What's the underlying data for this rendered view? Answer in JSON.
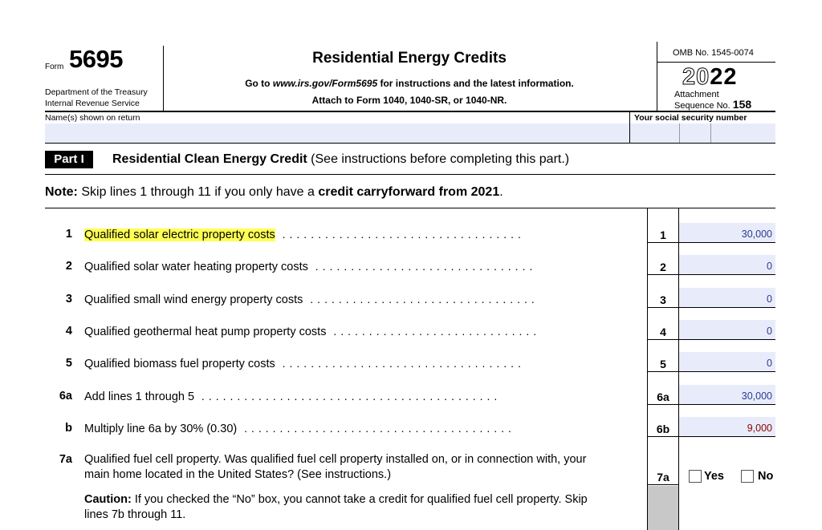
{
  "header": {
    "form_word": "Form",
    "form_number": "5695",
    "department": "Department of the Treasury",
    "agency": "Internal Revenue Service",
    "title": "Residential Energy Credits",
    "go_to_prefix": "Go to ",
    "go_to_url": "www.irs.gov/Form5695",
    "go_to_suffix": " for instructions and the latest information.",
    "attach": "Attach to Form 1040, 1040-SR, or 1040-NR.",
    "omb": "OMB No. 1545-0074",
    "year_outline": "20",
    "year_solid": "22",
    "attachment_label": "Attachment",
    "sequence_label": "Sequence No.",
    "sequence_no": "158"
  },
  "fields": {
    "name_label": "Name(s) shown on return",
    "ssn_label": "Your social security number"
  },
  "part1": {
    "badge": "Part I",
    "title": "Residential Clean Energy Credit",
    "title_note": " (See instructions before completing this part.)"
  },
  "note": {
    "label": "Note:",
    "text_pre": " Skip lines 1 through 11 if you only have a ",
    "text_bold": "credit carryforward from 2021",
    "text_post": "."
  },
  "lines": [
    {
      "num": "1",
      "text": "Qualified solar electric property costs",
      "box": "1",
      "value": "30,000"
    },
    {
      "num": "2",
      "text": "Qualified solar water heating property costs",
      "box": "2",
      "value": "0"
    },
    {
      "num": "3",
      "text": "Qualified small wind energy property costs",
      "box": "3",
      "value": "0"
    },
    {
      "num": "4",
      "text": "Qualified geothermal heat pump property costs",
      "box": "4",
      "value": "0"
    },
    {
      "num": "5",
      "text": "Qualified biomass fuel property costs",
      "box": "5",
      "value": "0"
    },
    {
      "num": "6a",
      "text": "Add lines 1 through 5",
      "box": "6a",
      "value": "30,000"
    },
    {
      "num": "b",
      "text": "Multiply line 6a by 30% (0.30)",
      "box": "6b",
      "value": "9,000"
    }
  ],
  "line7a": {
    "num": "7a",
    "text1": "Qualified fuel cell property. Was qualified fuel cell property installed on, or in connection with, your",
    "text2": "main home located in the United States? (See instructions.)",
    "box": "7a",
    "yes": "Yes",
    "no": "No"
  },
  "caution": {
    "label": "Caution:",
    "text1": " If you checked the “No” box, you cannot take a credit for qualified fuel cell property. Skip",
    "text2": "lines 7b through 11."
  },
  "colors": {
    "field_fill": "#e8ecfa",
    "highlight": "#ffff54",
    "value_text": "#2a3a8f",
    "value_red": "#8b0000"
  }
}
